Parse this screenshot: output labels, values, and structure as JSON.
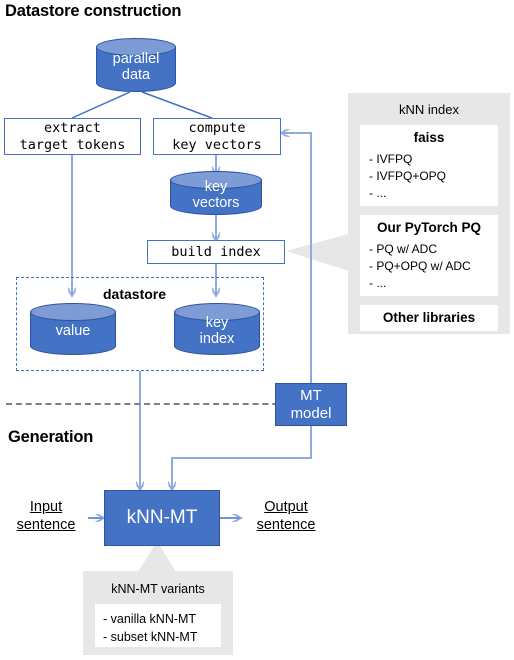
{
  "sections": {
    "datastore_construction": "Datastore construction",
    "generation": "Generation"
  },
  "nodes": {
    "parallel_data": "parallel\ndata",
    "parallel_data_l1": "parallel",
    "parallel_data_l2": "data",
    "extract_target_tokens_l1": "extract",
    "extract_target_tokens_l2": "target tokens",
    "compute_key_vectors_l1": "compute",
    "compute_key_vectors_l2": "key vectors",
    "key_vectors_l1": "key",
    "key_vectors_l2": "vectors",
    "build_index": "build index",
    "datastore_label": "datastore",
    "value": "value",
    "key_index_l1": "key",
    "key_index_l2": "index",
    "mt_model_l1": "MT",
    "mt_model_l2": "model",
    "knn_mt": "kNN-MT",
    "input_sentence_l1": "Input",
    "input_sentence_l2": "sentence",
    "output_sentence_l1": "Output",
    "output_sentence_l2": "sentence"
  },
  "knn_index_panel": {
    "title": "kNN index",
    "cards": [
      {
        "heading": "faiss",
        "items": [
          "- IVFPQ",
          "- IVFPQ+OPQ",
          "- ..."
        ]
      },
      {
        "heading": "Our PyTorch PQ",
        "items": [
          "- PQ w/ ADC",
          "- PQ+OPQ w/ ADC",
          "- ..."
        ]
      }
    ],
    "other": "Other libraries"
  },
  "variants_callout": {
    "title": "kNN-MT variants",
    "items": [
      "- vanilla kNN-MT",
      "- subset kNN-MT"
    ]
  },
  "colors": {
    "blue_fill": "#4472C4",
    "blue_light_top": "#7D9BD4",
    "blue_edge": "#2E53A0",
    "arrow_blue": "#8FAADC",
    "panel_gray": "#E7E7E7",
    "divider_gray": "#808080",
    "white": "#FFFFFF",
    "text_black": "#000000"
  }
}
